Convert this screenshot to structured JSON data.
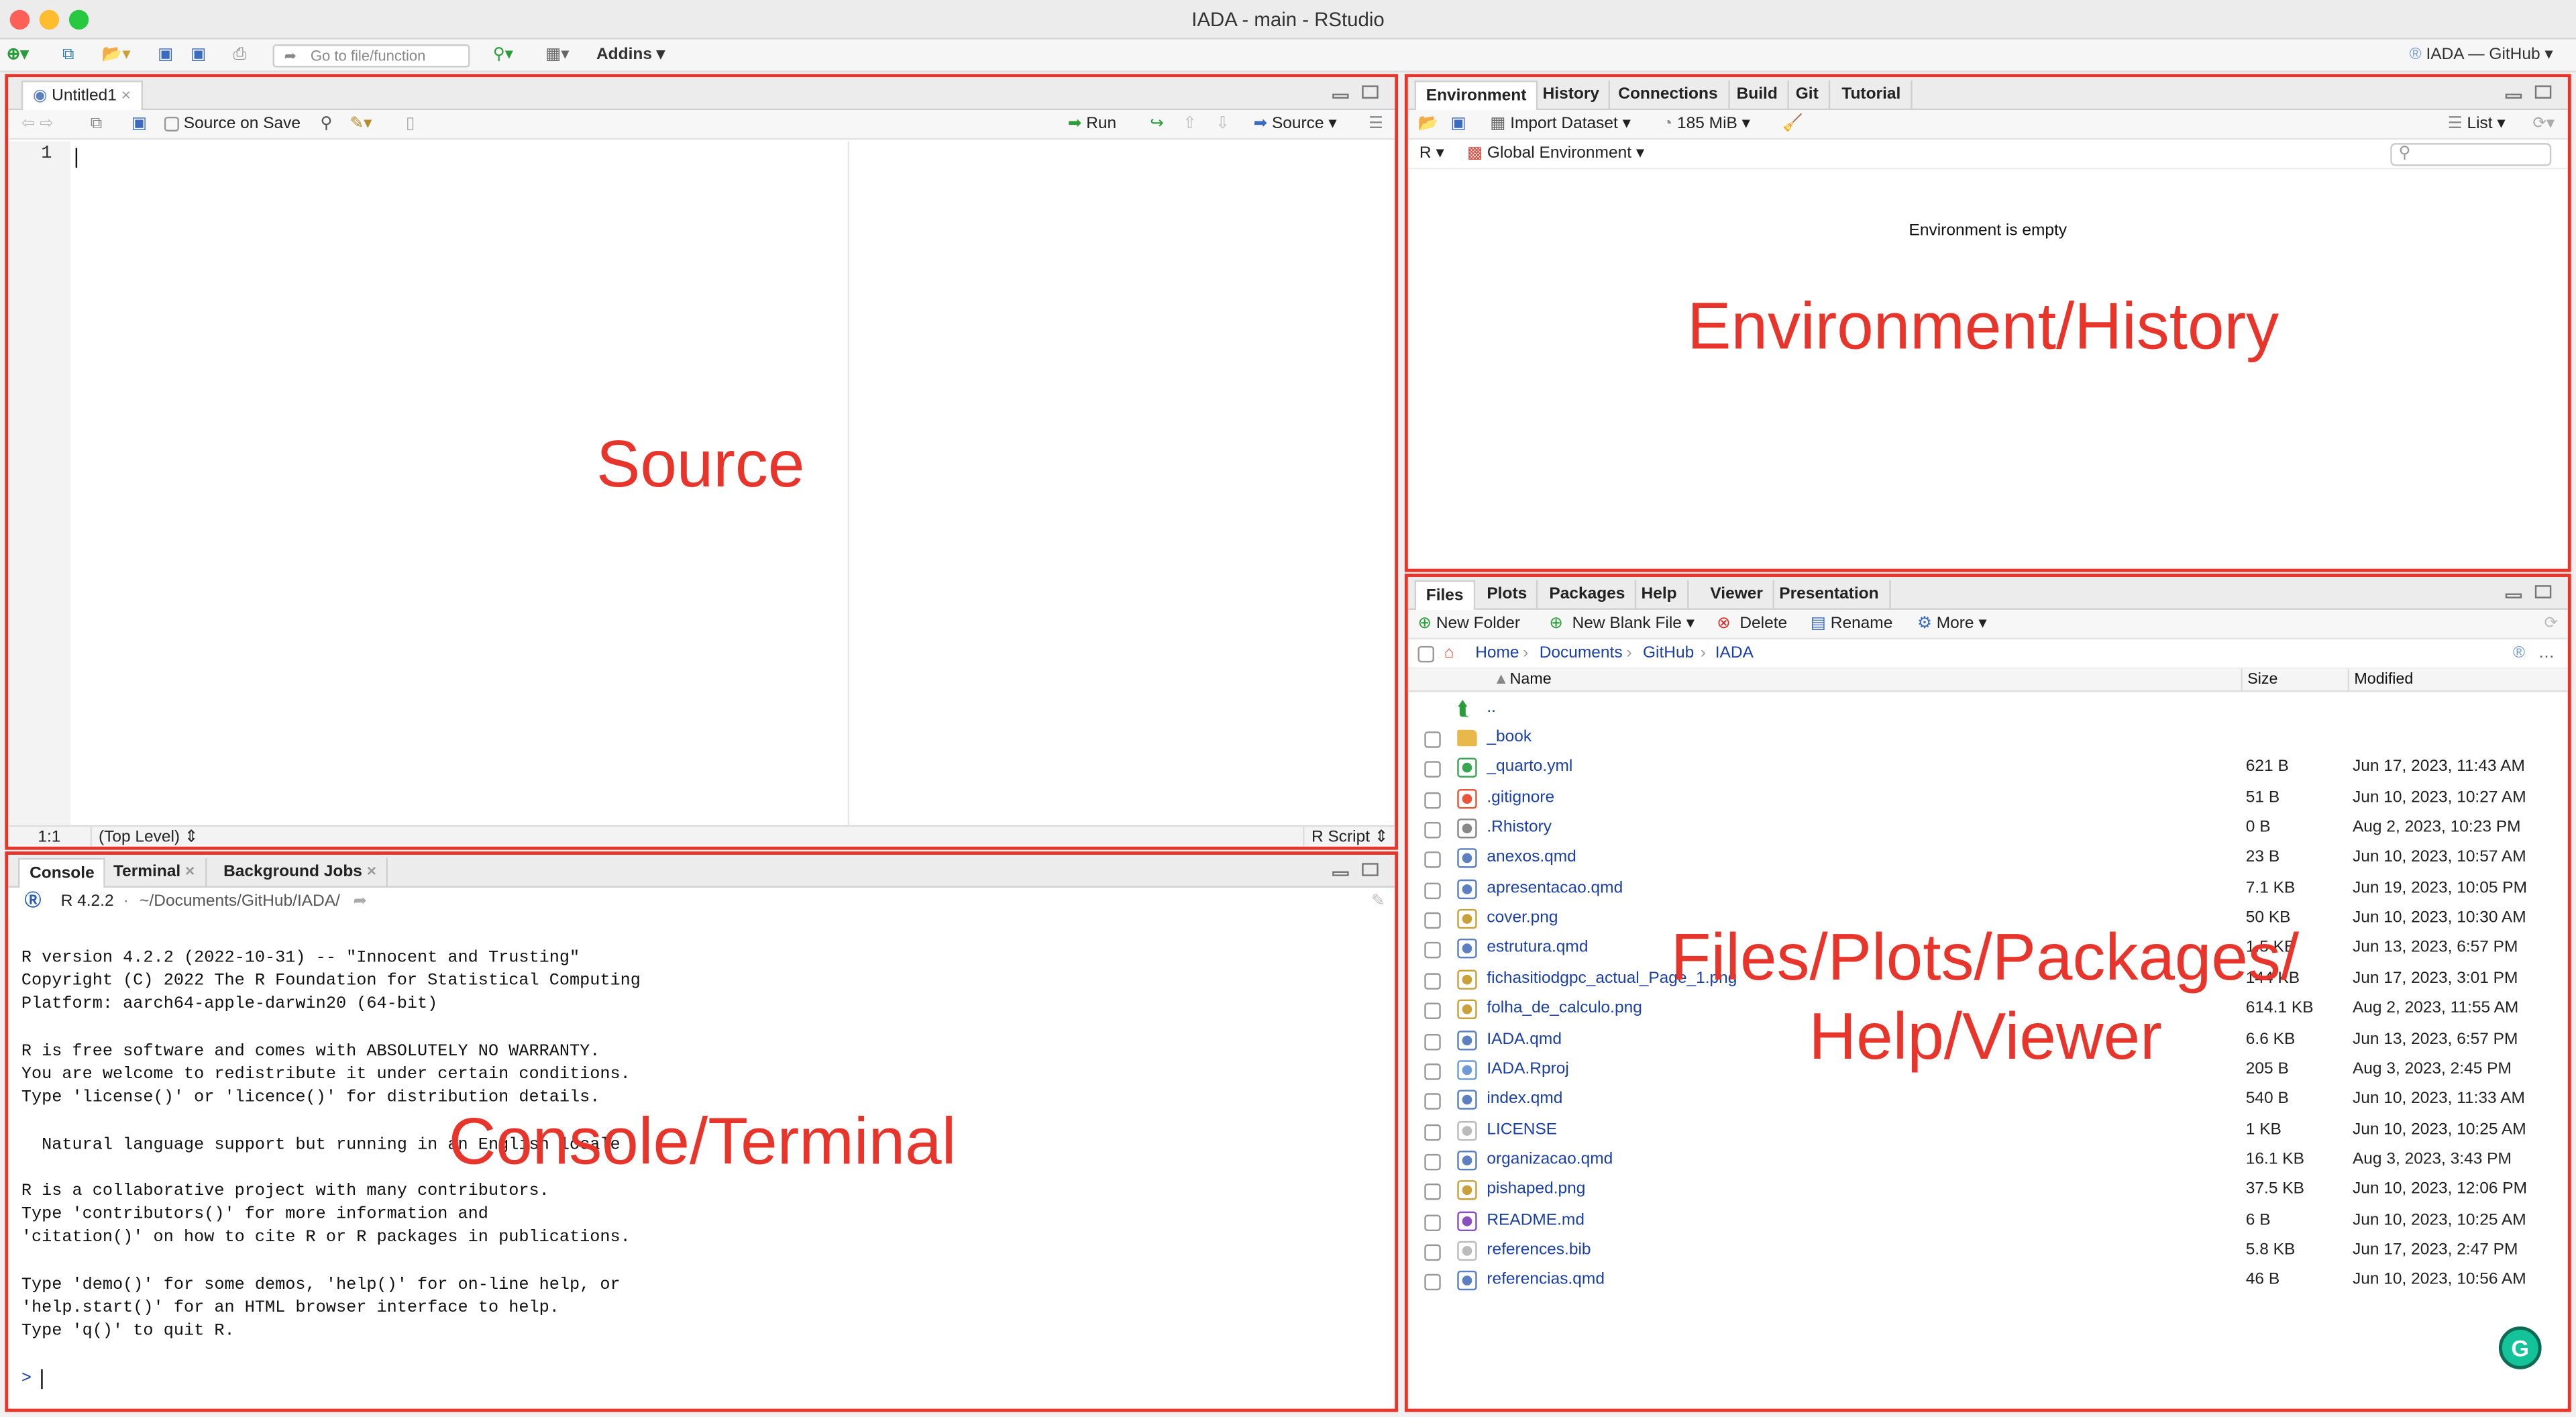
{
  "window": {
    "title": "IADA - main - RStudio"
  },
  "toolbar": {
    "goto_placeholder": "Go to file/function",
    "addins_label": "Addins",
    "project_label": "IADA — GitHub"
  },
  "source": {
    "tab_label": "Untitled1",
    "source_on_save": "Source on Save",
    "run_label": "Run",
    "source_label": "Source",
    "line_number": "1",
    "position": "1:1",
    "scope": "(Top Level)",
    "file_type": "R Script",
    "region_label": "Source"
  },
  "console": {
    "tabs": [
      "Console",
      "Terminal",
      "Background Jobs"
    ],
    "r_version": "R 4.2.2",
    "path": "~/Documents/GitHub/IADA/",
    "lines": [
      "R version 4.2.2 (2022-10-31) -- \"Innocent and Trusting\"",
      "Copyright (C) 2022 The R Foundation for Statistical Computing",
      "Platform: aarch64-apple-darwin20 (64-bit)",
      "",
      "R is free software and comes with ABSOLUTELY NO WARRANTY.",
      "You are welcome to redistribute it under certain conditions.",
      "Type 'license()' or 'licence()' for distribution details.",
      "",
      "  Natural language support but running in an English locale",
      "",
      "R is a collaborative project with many contributors.",
      "Type 'contributors()' for more information and",
      "'citation()' on how to cite R or R packages in publications.",
      "",
      "Type 'demo()' for some demos, 'help()' for on-line help, or",
      "'help.start()' for an HTML browser interface to help.",
      "Type 'q()' to quit R."
    ],
    "prompt": ">",
    "region_label": "Console/Terminal"
  },
  "environment": {
    "tabs": [
      "Environment",
      "History",
      "Connections",
      "Build",
      "Git",
      "Tutorial"
    ],
    "import_dataset": "Import Dataset",
    "memory": "185 MiB",
    "list_label": "List",
    "lang": "R",
    "scope": "Global Environment",
    "empty_message": "Environment is empty",
    "region_label": "Environment/History"
  },
  "files": {
    "tabs": [
      "Files",
      "Plots",
      "Packages",
      "Help",
      "Viewer",
      "Presentation"
    ],
    "new_folder": "New Folder",
    "new_blank_file": "New Blank File",
    "delete": "Delete",
    "rename": "Rename",
    "more": "More",
    "breadcrumb": [
      "Home",
      "Documents",
      "GitHub",
      "IADA"
    ],
    "columns": {
      "name": "Name",
      "size": "Size",
      "modified": "Modified"
    },
    "up_label": "..",
    "rows": [
      {
        "name": "_book",
        "size": "",
        "modified": "",
        "icon": "folder-icon",
        "color": "#e8b84a"
      },
      {
        "name": "_quarto.yml",
        "size": "621 B",
        "modified": "Jun 17, 2023, 11:43 AM",
        "icon": "yml-icon",
        "color": "#3aa655"
      },
      {
        "name": ".gitignore",
        "size": "51 B",
        "modified": "Jun 10, 2023, 10:27 AM",
        "icon": "git-icon",
        "color": "#e8553b"
      },
      {
        "name": ".Rhistory",
        "size": "0 B",
        "modified": "Aug 2, 2023, 10:23 PM",
        "icon": "history-icon",
        "color": "#888888"
      },
      {
        "name": "anexos.qmd",
        "size": "23 B",
        "modified": "Jun 10, 2023, 10:57 AM",
        "icon": "qmd-icon",
        "color": "#5b7fbf"
      },
      {
        "name": "apresentacao.qmd",
        "size": "7.1 KB",
        "modified": "Jun 19, 2023, 10:05 PM",
        "icon": "qmd-icon",
        "color": "#5b7fbf"
      },
      {
        "name": "cover.png",
        "size": "50 KB",
        "modified": "Jun 10, 2023, 10:30 AM",
        "icon": "image-icon",
        "color": "#c9a13a"
      },
      {
        "name": "estrutura.qmd",
        "size": "1.5 KB",
        "modified": "Jun 13, 2023, 6:57 PM",
        "icon": "qmd-icon",
        "color": "#5b7fbf"
      },
      {
        "name": "fichasitiodgpc_actual_Page_1.png",
        "size": "144 KB",
        "modified": "Jun 17, 2023, 3:01 PM",
        "icon": "image-icon",
        "color": "#c9a13a"
      },
      {
        "name": "folha_de_calculo.png",
        "size": "614.1 KB",
        "modified": "Aug 2, 2023, 11:55 AM",
        "icon": "image-icon",
        "color": "#c9a13a"
      },
      {
        "name": "IADA.qmd",
        "size": "6.6 KB",
        "modified": "Jun 13, 2023, 6:57 PM",
        "icon": "qmd-icon",
        "color": "#5b7fbf"
      },
      {
        "name": "IADA.Rproj",
        "size": "205 B",
        "modified": "Aug 3, 2023, 2:45 PM",
        "icon": "rproj-icon",
        "color": "#6e9bd6"
      },
      {
        "name": "index.qmd",
        "size": "540 B",
        "modified": "Jun 10, 2023, 11:33 AM",
        "icon": "qmd-icon",
        "color": "#5b7fbf"
      },
      {
        "name": "LICENSE",
        "size": "1 KB",
        "modified": "Jun 10, 2023, 10:25 AM",
        "icon": "blank-file-icon",
        "color": "#bbbbbb"
      },
      {
        "name": "organizacao.qmd",
        "size": "16.1 KB",
        "modified": "Aug 3, 2023, 3:43 PM",
        "icon": "qmd-icon",
        "color": "#5b7fbf"
      },
      {
        "name": "pishaped.png",
        "size": "37.5 KB",
        "modified": "Jun 10, 2023, 12:06 PM",
        "icon": "image-icon",
        "color": "#c9a13a"
      },
      {
        "name": "README.md",
        "size": "6 B",
        "modified": "Jun 10, 2023, 10:25 AM",
        "icon": "markdown-icon",
        "color": "#8a4fbf"
      },
      {
        "name": "references.bib",
        "size": "5.8 KB",
        "modified": "Jun 17, 2023, 2:47 PM",
        "icon": "blank-file-icon",
        "color": "#bbbbbb"
      },
      {
        "name": "referencias.qmd",
        "size": "46 B",
        "modified": "Jun 10, 2023, 10:56 AM",
        "icon": "qmd-icon",
        "color": "#5b7fbf"
      }
    ],
    "region_label_1": "Files/Plots/Packages/",
    "region_label_2": "Help/Viewer"
  },
  "colors": {
    "annotation": "#e8352b",
    "link": "#1a3fa6",
    "grammarly": "#15c39a"
  }
}
